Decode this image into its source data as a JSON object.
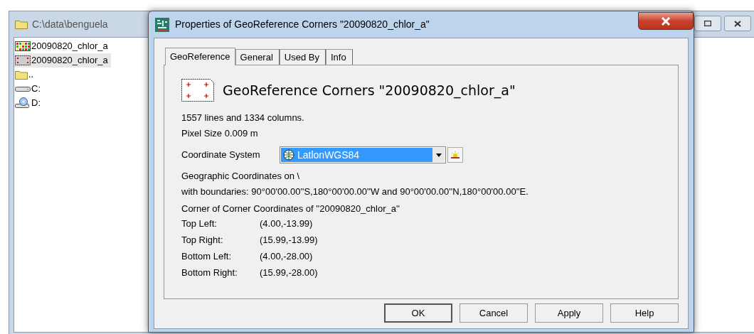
{
  "background_window": {
    "title": "C:\\data\\benguela",
    "items": [
      {
        "label": "20090820_chlor_a",
        "kind": "raster",
        "selected": false
      },
      {
        "label": "20090820_chlor_a",
        "kind": "georef",
        "selected": true
      },
      {
        "label": "..",
        "kind": "folder",
        "selected": false
      },
      {
        "label": "C:",
        "kind": "drive",
        "selected": false
      },
      {
        "label": "D:",
        "kind": "cdrom",
        "selected": false
      }
    ]
  },
  "dialog": {
    "title": "Properties of GeoReference Corners \"20090820_chlor_a\"",
    "tabs": [
      {
        "label": "GeoReference",
        "selected": true
      },
      {
        "label": "General",
        "selected": false
      },
      {
        "label": "Used By",
        "selected": false
      },
      {
        "label": "Info",
        "selected": false
      }
    ],
    "heading": "GeoReference Corners \"20090820_chlor_a\"",
    "info_lines": [
      "1557 lines and 1334 columns.",
      "Pixel Size 0.009 m"
    ],
    "coordinate_system": {
      "label": "Coordinate System",
      "value": "LatlonWGS84"
    },
    "geo_lines": [
      "Geographic Coordinates on \\",
      "with boundaries:  90°00'00.00''S,180°00'00.00''W and  90°00'00.00''N,180°00'00.00''E."
    ],
    "corners_heading": "Corner of Corner Coordinates of ''20090820_chlor_a''",
    "corners": [
      {
        "label": "Top Left:",
        "value": "(4.00,-13.99)"
      },
      {
        "label": "Top Right:",
        "value": "(15.99,-13.99)"
      },
      {
        "label": "Bottom Left:",
        "value": "(4.00,-28.00)"
      },
      {
        "label": "Bottom Right:",
        "value": "(15.99,-28.00)"
      }
    ],
    "buttons": [
      {
        "label": "OK",
        "default": true
      },
      {
        "label": "Cancel",
        "default": false
      },
      {
        "label": "Apply",
        "default": false
      },
      {
        "label": "Help",
        "default": false
      }
    ]
  }
}
